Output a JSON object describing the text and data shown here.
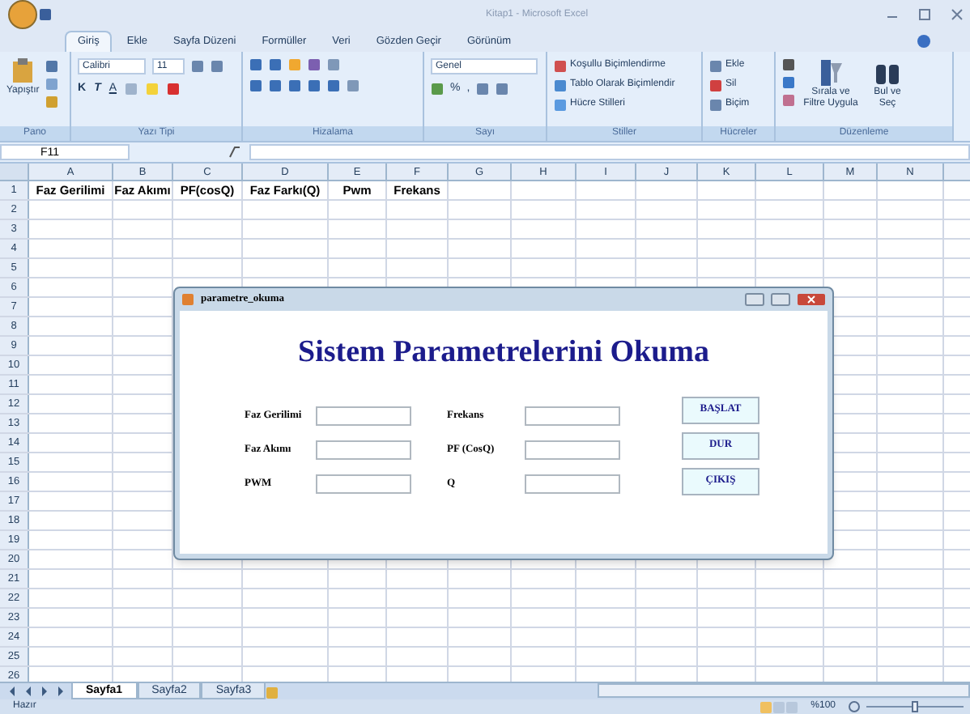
{
  "window": {
    "title": "Kitap1 - Microsoft Excel"
  },
  "tabs": [
    {
      "label": "Giriş",
      "selected": true
    },
    {
      "label": "Ekle",
      "selected": false
    },
    {
      "label": "Sayfa Düzeni",
      "selected": false
    },
    {
      "label": "Formüller",
      "selected": false
    },
    {
      "label": "Veri",
      "selected": false
    },
    {
      "label": "Gözden Geçir",
      "selected": false
    },
    {
      "label": "Görünüm",
      "selected": false
    }
  ],
  "ribbon": {
    "paste": "Yapıştır",
    "font": "Calibri",
    "size": "11",
    "bold": "K",
    "italic": "T",
    "underline": "A",
    "number_format": "Genel",
    "percent": "%",
    "comma": ",",
    "styles": [
      "Koşullu Biçimlendirme",
      "Tablo Olarak Biçimlendir",
      "Hücre Stilleri"
    ],
    "cells": [
      "Ekle",
      "Sil",
      "Biçim"
    ],
    "sort": "Sırala ve Filtre Uygula",
    "find": "Bul ve Seç",
    "groups": [
      "Pano",
      "Yazı Tipi",
      "Hizalama",
      "Sayı",
      "Stiller",
      "Hücreler",
      "Düzenleme"
    ]
  },
  "name_box": "F11",
  "columns": [
    "A",
    "B",
    "C",
    "D",
    "E",
    "F",
    "G",
    "H",
    "I",
    "J",
    "K",
    "L",
    "M",
    "N"
  ],
  "header_row": [
    "Faz Gerilimi",
    "Faz Akımı",
    "PF(cosQ)",
    "Faz Farkı(Q)",
    "Pwm",
    "Frekans"
  ],
  "row_numbers": [
    "1",
    "2",
    "3",
    "4",
    "5",
    "6",
    "7",
    "8",
    "9",
    "10",
    "11",
    "12",
    "13",
    "14",
    "15",
    "16",
    "17",
    "18",
    "19",
    "20",
    "21",
    "22",
    "23",
    "24",
    "25",
    "26"
  ],
  "sheets": [
    {
      "label": "Sayfa1",
      "selected": true
    },
    {
      "label": "Sayfa2",
      "selected": false
    },
    {
      "label": "Sayfa3",
      "selected": false
    }
  ],
  "status": {
    "text": "Hazır",
    "zoom": "%100",
    "level": 0.5
  },
  "dialog": {
    "title": "parametre_okuma",
    "heading": "Sistem Parametrelerini Okuma",
    "left_fields": [
      "Faz Gerilimi",
      "Faz Akımı",
      "PWM"
    ],
    "right_fields": [
      "Frekans",
      "PF (CosQ)",
      "Q"
    ],
    "buttons": [
      "BAŞLAT",
      "DUR",
      "ÇIKIŞ"
    ]
  }
}
